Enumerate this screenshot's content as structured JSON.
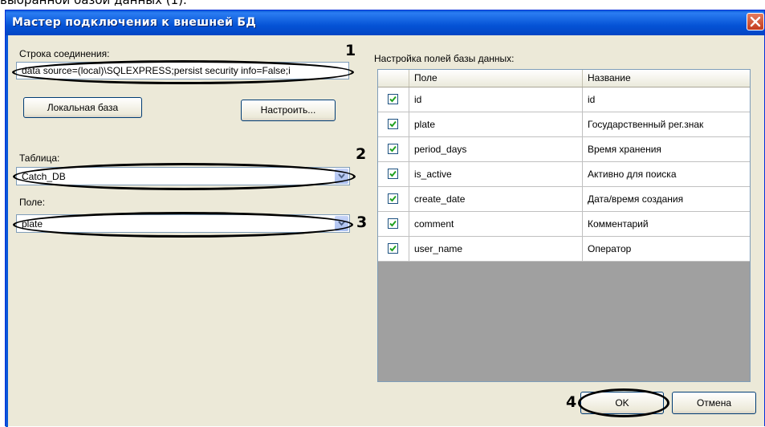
{
  "caption_fragment": "выбранной базой данных (1).",
  "window": {
    "title": "Мастер подключения к внешней БД"
  },
  "connection": {
    "label": "Строка соединения:",
    "value": "data source=(local)\\SQLEXPRESS;persist security info=False;i",
    "local_button": "Локальная база",
    "configure_button": "Настроить..."
  },
  "table": {
    "label": "Таблица:",
    "value": "Catch_DB"
  },
  "field": {
    "label": "Поле:",
    "value": "plate"
  },
  "fields_grid": {
    "label": "Настройка полей базы данных:",
    "columns": [
      "Поле",
      "Название"
    ],
    "rows": [
      {
        "checked": true,
        "field": "id",
        "name": "id"
      },
      {
        "checked": true,
        "field": "plate",
        "name": "Государственный рег.знак"
      },
      {
        "checked": true,
        "field": "period_days",
        "name": "Время хранения"
      },
      {
        "checked": true,
        "field": "is_active",
        "name": "Активно для поиска"
      },
      {
        "checked": true,
        "field": "create_date",
        "name": "Дата/время создания"
      },
      {
        "checked": true,
        "field": "comment",
        "name": "Комментарий"
      },
      {
        "checked": true,
        "field": "user_name",
        "name": "Оператор"
      }
    ]
  },
  "buttons": {
    "ok": "OK",
    "cancel": "Отмена"
  },
  "callouts": [
    "1",
    "2",
    "3",
    "4"
  ],
  "colors": {
    "titlebar": "#0553d6",
    "dialog_bg": "#ece9d8",
    "check": "#21a121"
  }
}
